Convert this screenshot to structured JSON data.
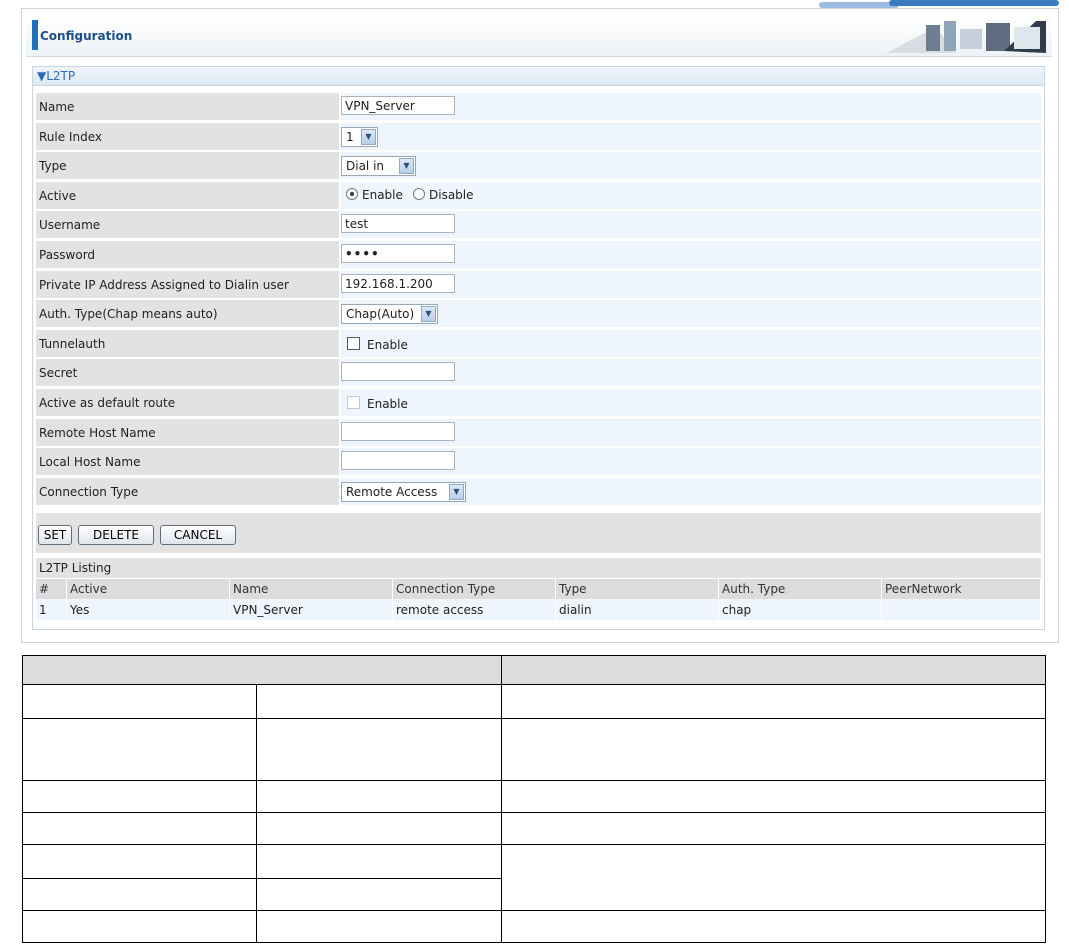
{
  "header": {
    "title": "Configuration"
  },
  "section": {
    "title": "▼L2TP"
  },
  "fields": {
    "name": {
      "label": "Name",
      "value": "VPN_Server"
    },
    "rule_index": {
      "label": "Rule Index",
      "value": "1"
    },
    "type": {
      "label": "Type",
      "value": "Dial in"
    },
    "active": {
      "label": "Active",
      "option_enable": "Enable",
      "option_disable": "Disable",
      "selected": "Enable"
    },
    "username": {
      "label": "Username",
      "value": "test"
    },
    "password": {
      "label": "Password",
      "value": "••••"
    },
    "private_ip": {
      "label": "Private IP Address Assigned to Dialin user",
      "value": "192.168.1.200"
    },
    "auth_type": {
      "label": "Auth. Type(Chap means auto)",
      "value": "Chap(Auto)"
    },
    "tunnelauth": {
      "label": "Tunnelauth",
      "checkbox_label": "Enable"
    },
    "secret": {
      "label": "Secret",
      "value": ""
    },
    "default_route": {
      "label": "Active as default route",
      "checkbox_label": "Enable"
    },
    "remote_host": {
      "label": "Remote Host Name",
      "value": ""
    },
    "local_host": {
      "label": "Local Host Name",
      "value": ""
    },
    "connection_type": {
      "label": "Connection Type",
      "value": "Remote Access"
    }
  },
  "buttons": {
    "set": "SET",
    "delete": "DELETE",
    "cancel": "CANCEL"
  },
  "listing": {
    "title": "L2TP Listing",
    "columns": [
      "#",
      "Active",
      "Name",
      "Connection Type",
      "Type",
      "Auth. Type",
      "PeerNetwork"
    ],
    "rows": [
      [
        "1",
        "Yes",
        "VPN_Server",
        "remote access",
        "dialin",
        "chap",
        ""
      ]
    ]
  },
  "colors": {
    "accent": "#1f6fbf",
    "label_bg": "#e2e2e2",
    "value_bg": "#eef5fc"
  }
}
